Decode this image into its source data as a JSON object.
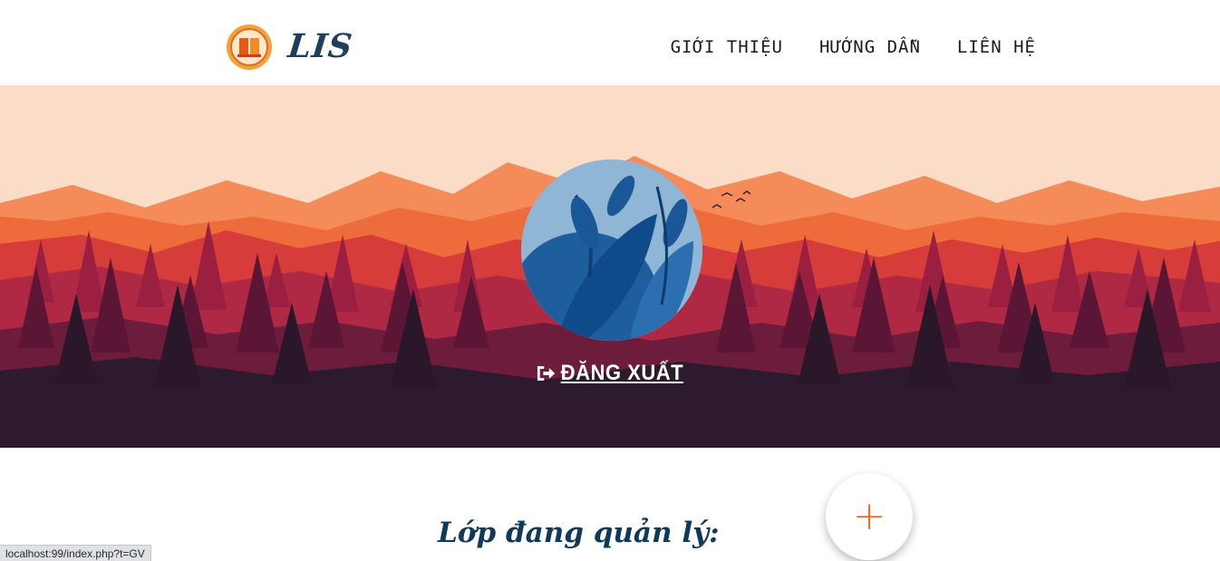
{
  "header": {
    "brand": "LIS",
    "nav": [
      {
        "label": "GIỚI THIỆU"
      },
      {
        "label": "HƯỚNG DẪN"
      },
      {
        "label": "LIÊN HỆ"
      }
    ]
  },
  "hero": {
    "logout_label": "ĐĂNG XUẤT"
  },
  "main": {
    "section_title": "Lớp đang quản lý:",
    "add_label": "+"
  },
  "status_bar": {
    "url": "localhost:99/index.php?t=GV"
  },
  "colors": {
    "accent": "#ef6a2c",
    "brand": "#1d3e5c",
    "hero_sky": "#fbdcc6",
    "hero_dark": "#2e1a2e"
  },
  "icons": {
    "logo": "school-logo-icon",
    "logout": "sign-out-icon",
    "add": "plus-icon"
  }
}
